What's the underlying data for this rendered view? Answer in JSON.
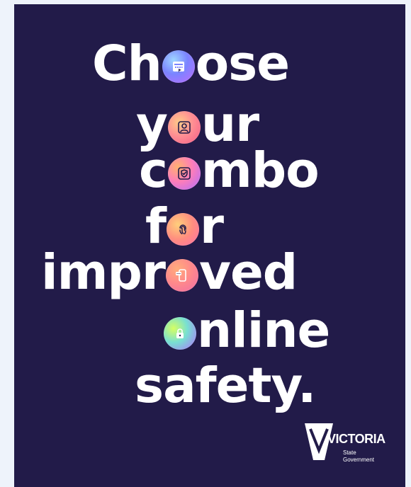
{
  "poster": {
    "background_color": "#221b49",
    "text_color": "#ffffff",
    "lines": [
      {
        "before": "Ch",
        "after": "ose"
      },
      {
        "before": "y",
        "after": "ur"
      },
      {
        "before": "c",
        "after": "mbo"
      },
      {
        "before": "f",
        "after": "r"
      },
      {
        "before": "impr",
        "after": "ved"
      },
      {
        "before": "",
        "after": "nline"
      },
      {
        "text": "safety."
      }
    ],
    "icons": [
      "calendar-card-icon",
      "user-icon",
      "shield-check-icon",
      "fingerprint-icon",
      "phone-message-icon",
      "lock-icon"
    ]
  },
  "logo": {
    "text": "VICTORIA",
    "sub1": "State",
    "sub2": "Government"
  }
}
